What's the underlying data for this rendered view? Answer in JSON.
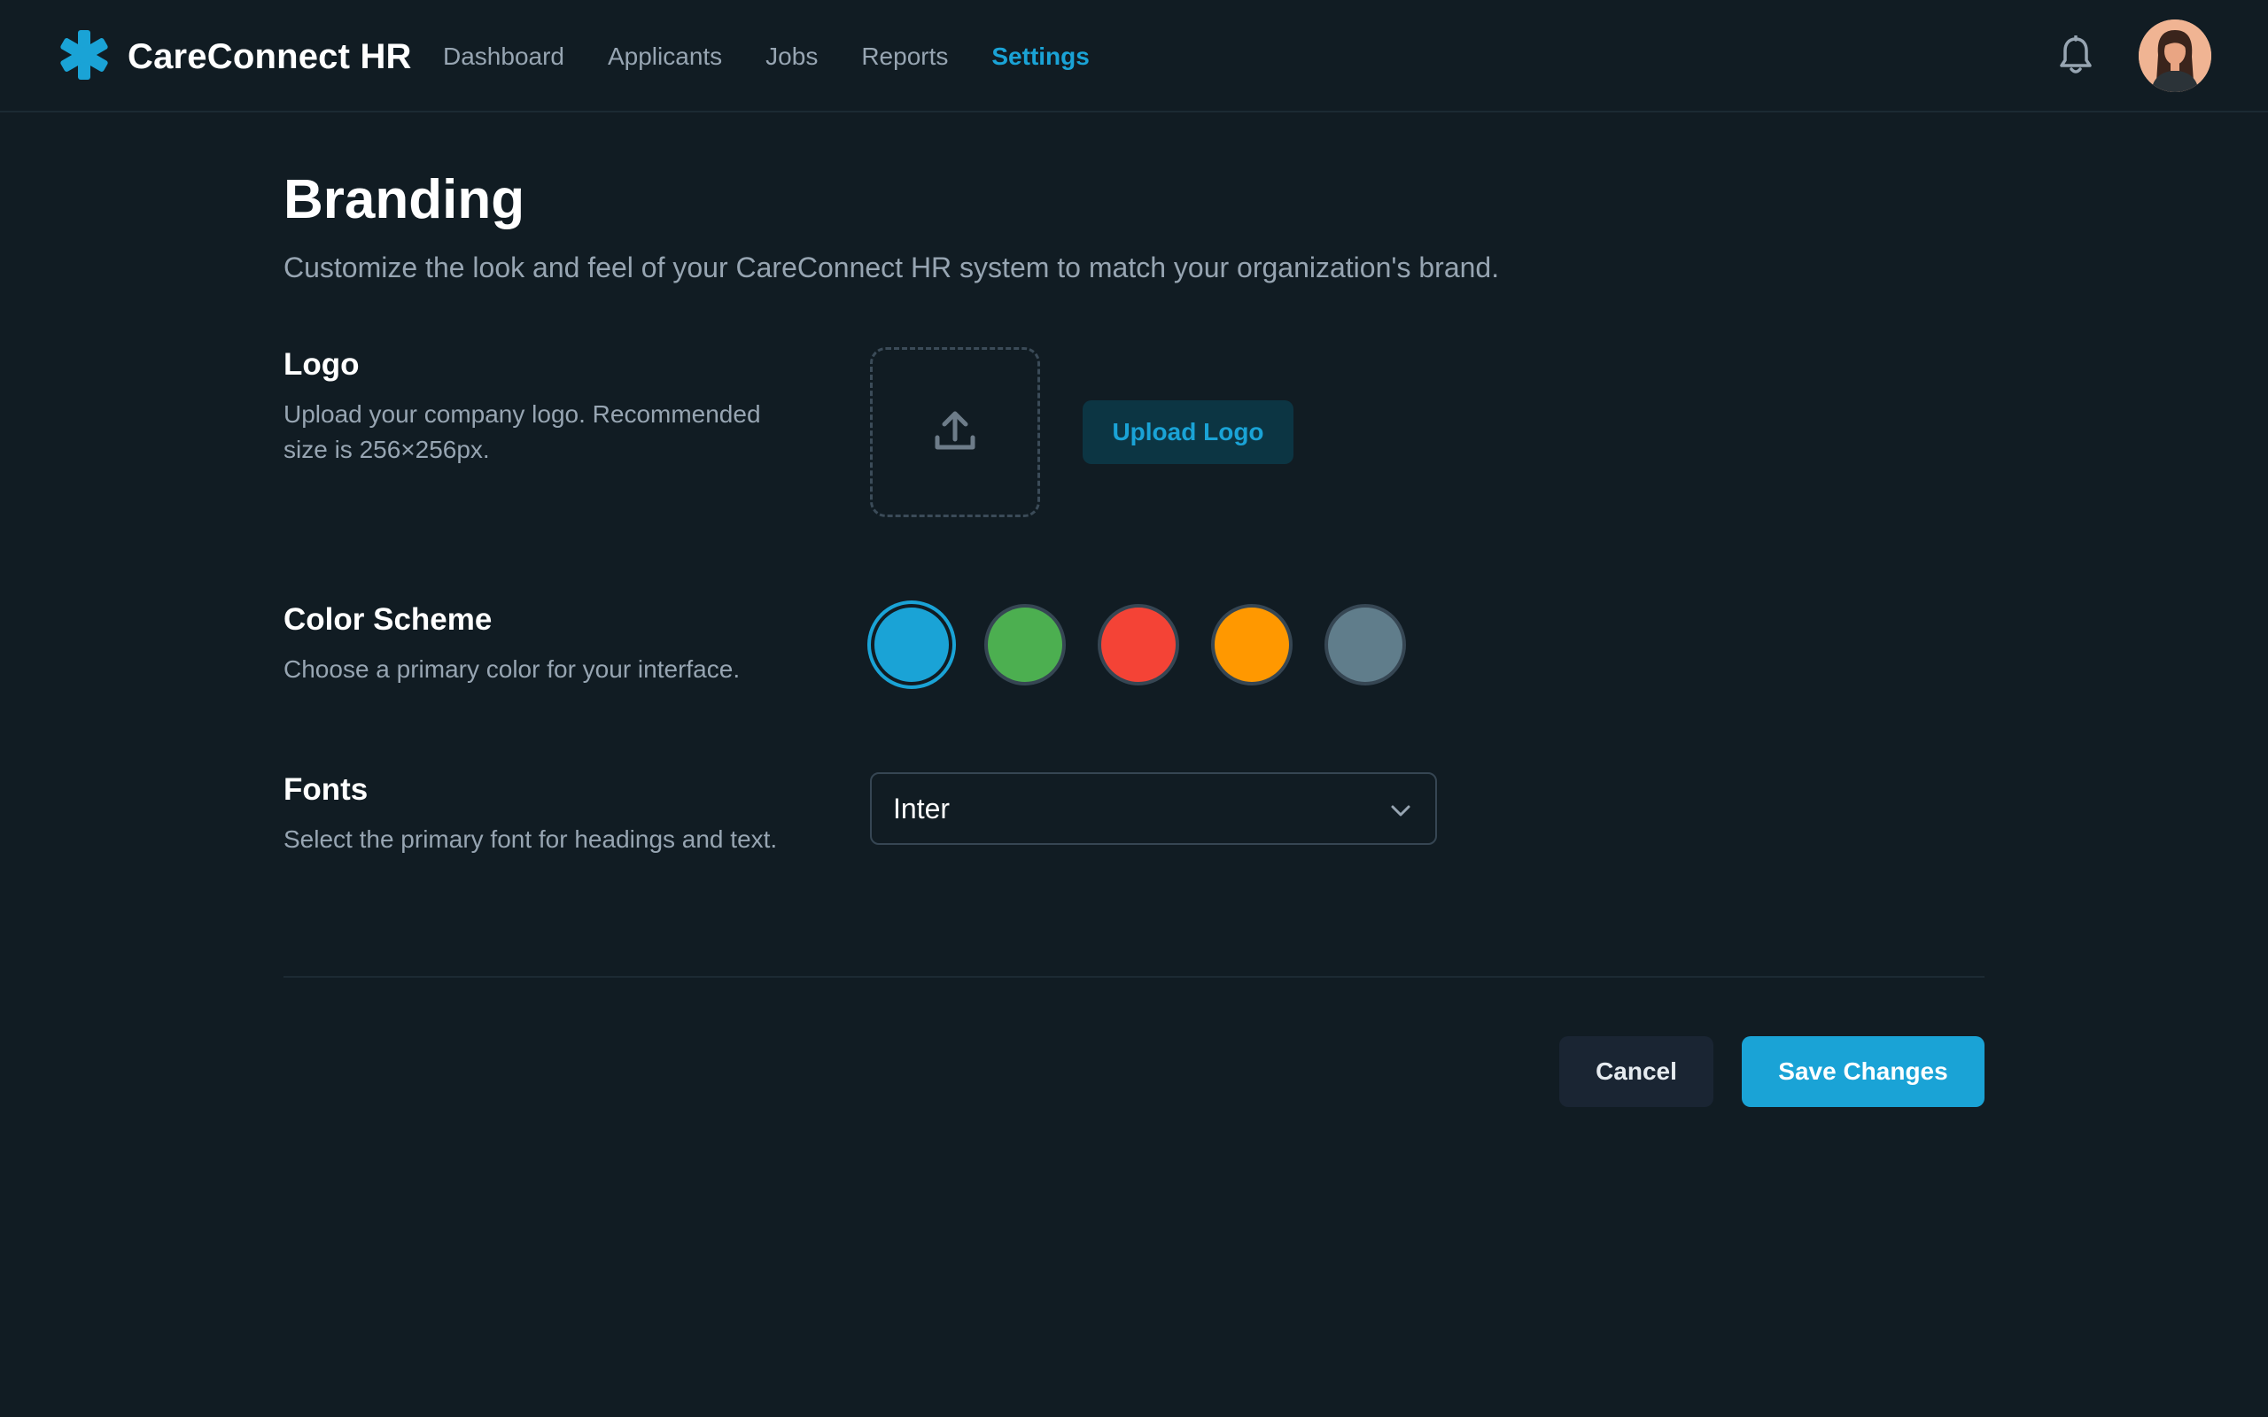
{
  "header": {
    "app_name": "CareConnect HR",
    "logo_icon": "asterisk-icon",
    "nav": [
      {
        "label": "Dashboard",
        "active": false
      },
      {
        "label": "Applicants",
        "active": false
      },
      {
        "label": "Jobs",
        "active": false
      },
      {
        "label": "Reports",
        "active": false
      },
      {
        "label": "Settings",
        "active": true
      }
    ],
    "notification_icon": "bell-icon",
    "avatar_icon": "user-avatar"
  },
  "page": {
    "title": "Branding",
    "subtitle": "Customize the look and feel of your CareConnect HR system to match your organization's brand."
  },
  "logo_section": {
    "title": "Logo",
    "description": "Upload your company logo. Recommended size is 256×256px.",
    "dropzone_icon": "upload-icon",
    "upload_button": "Upload Logo"
  },
  "color_section": {
    "title": "Color Scheme",
    "description": "Choose a primary color for your interface.",
    "swatches": [
      {
        "color": "#1aa3d6",
        "selected": true
      },
      {
        "color": "#4caf50",
        "selected": false
      },
      {
        "color": "#f44336",
        "selected": false
      },
      {
        "color": "#ff9800",
        "selected": false
      },
      {
        "color": "#607d8b",
        "selected": false
      }
    ]
  },
  "font_section": {
    "title": "Fonts",
    "description": "Select the primary font for headings and text.",
    "selected_font": "Inter",
    "dropdown_icon": "chevron-down-icon"
  },
  "actions": {
    "cancel_label": "Cancel",
    "save_label": "Save Changes"
  },
  "colors": {
    "accent": "#1aa3d6",
    "background": "#111c23",
    "muted_text": "#97a5b2"
  }
}
